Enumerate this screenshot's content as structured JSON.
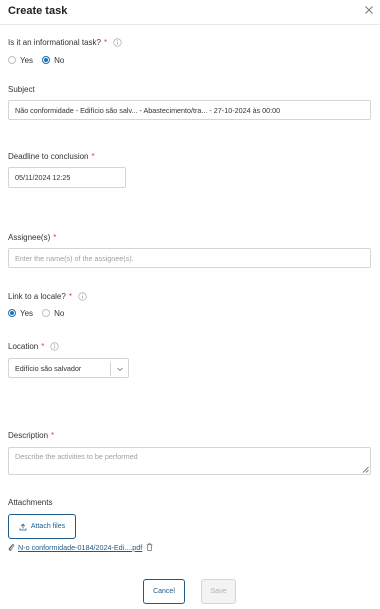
{
  "dialog": {
    "title": "Create task"
  },
  "informational": {
    "label": "Is it an informational task?",
    "required_mark": "*",
    "options": [
      "Yes",
      "No"
    ],
    "selected": "No"
  },
  "subject": {
    "label": "Subject",
    "value": "Não conformidade - Edifício são salv... - Abastecimento/tra... - 27-10-2024 às 00:00"
  },
  "deadline": {
    "label": "Deadline to conclusion",
    "required_mark": "*",
    "value": "05/11/2024 12:25"
  },
  "assignees": {
    "label": "Assignee(s)",
    "required_mark": "*",
    "placeholder": "Enter the name(s) of the assignee(s)."
  },
  "locale": {
    "label": "Link to a locale?",
    "required_mark": "*",
    "options": [
      "Yes",
      "No"
    ],
    "selected": "Yes"
  },
  "location": {
    "label": "Location",
    "required_mark": "*",
    "value": "Edifício são salvador"
  },
  "description": {
    "label": "Description",
    "required_mark": "*",
    "placeholder": "Describe the activities to be performed"
  },
  "attachments": {
    "label": "Attachments",
    "button_label": "Attach files",
    "file_name": "N-o conformidade-0184/2024-Edi....pdf"
  },
  "footer": {
    "cancel_label": "Cancel",
    "save_label": "Save"
  },
  "colors": {
    "accent": "#1e6fb5",
    "button_border": "#1e5a8a",
    "required": "#d9443d"
  },
  "icons": {
    "close": "close-icon",
    "info": "info-icon",
    "upload": "upload-icon",
    "paperclip": "paperclip-icon",
    "trash": "trash-icon",
    "chevron": "chevron-down-icon"
  }
}
